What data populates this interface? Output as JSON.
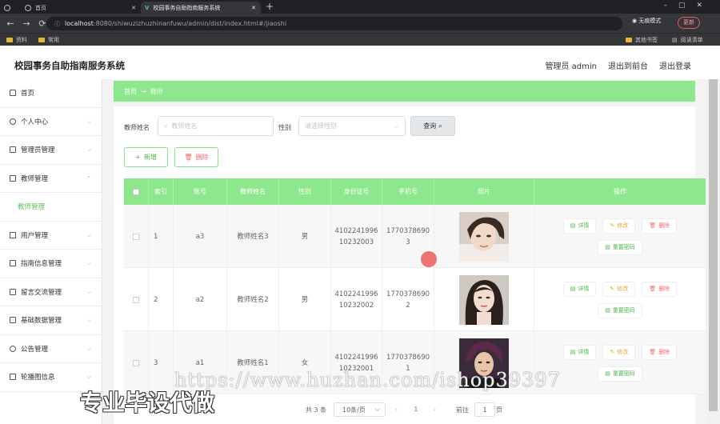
{
  "browser": {
    "tabs": [
      {
        "label": ""
      },
      {
        "label": "首页"
      },
      {
        "label": "校园事务自助指南服务系统"
      }
    ],
    "url_host": "localhost",
    "url_path": ":8080/shiwuzizhuzhinanfuwu/admin/dist/index.html#/jiaoshi",
    "incognito_label": "无痕模式",
    "update_label": "更新",
    "bookmarks": [
      "资料",
      "常用"
    ],
    "other_bookmarks": "其他书签",
    "reading_list": "阅读清单"
  },
  "header": {
    "title": "校园事务自助指南服务系统",
    "user": "管理员 admin",
    "back_front": "退出到前台",
    "logout": "退出登录"
  },
  "sidebar": {
    "items": [
      {
        "label": "首页",
        "icon": "home-icon"
      },
      {
        "label": "个人中心",
        "icon": "user-icon"
      },
      {
        "label": "管理员管理",
        "icon": "admin-icon"
      },
      {
        "label": "教师管理",
        "icon": "teacher-icon"
      },
      {
        "label": "教师管理",
        "icon": ""
      },
      {
        "label": "用户管理",
        "icon": "grid-icon"
      },
      {
        "label": "指南信息管理",
        "icon": "message-icon"
      },
      {
        "label": "留言交流管理",
        "icon": "folder-icon"
      },
      {
        "label": "基础数据管理",
        "icon": "table-icon"
      },
      {
        "label": "公告管理",
        "icon": "mic-icon"
      },
      {
        "label": "轮播图信息",
        "icon": "monitor-icon"
      }
    ]
  },
  "breadcrumb": {
    "home": "首页",
    "current": "教师"
  },
  "filters": {
    "name_label": "教师姓名",
    "name_placeholder": "教师姓名",
    "gender_label": "性别",
    "gender_placeholder": "请选择性别",
    "search_button": "查询"
  },
  "actions": {
    "add": "新增",
    "delete": "删除"
  },
  "table": {
    "columns": [
      "",
      "索引",
      "账号",
      "教师姓名",
      "性别",
      "身份证号",
      "手机号",
      "照片",
      "操作"
    ],
    "rows": [
      {
        "index": "1",
        "account": "a3",
        "name": "教师姓名3",
        "gender": "男",
        "id_card": "410224199610232003",
        "phone": "17703786903"
      },
      {
        "index": "2",
        "account": "a2",
        "name": "教师姓名2",
        "gender": "男",
        "id_card": "410224199610232002",
        "phone": "17703786902"
      },
      {
        "index": "3",
        "account": "a1",
        "name": "教师姓名1",
        "gender": "女",
        "id_card": "410224199610232001",
        "phone": "17703786901"
      }
    ],
    "op_labels": {
      "detail": "详情",
      "edit": "修改",
      "delete": "删除",
      "reset": "重置密码"
    }
  },
  "pagination": {
    "total": "共 3 条",
    "page_size": "10条/页",
    "current": "1",
    "goto_label": "前往",
    "goto_value": "1",
    "page_suffix": "页"
  },
  "watermark": {
    "url_text": "https://www.huzhan.com/ishop39397",
    "slogan": "专业毕设代做"
  },
  "colors": {
    "accent": "#8de88d",
    "danger": "#f56c6c",
    "warning": "#e6a23c"
  }
}
